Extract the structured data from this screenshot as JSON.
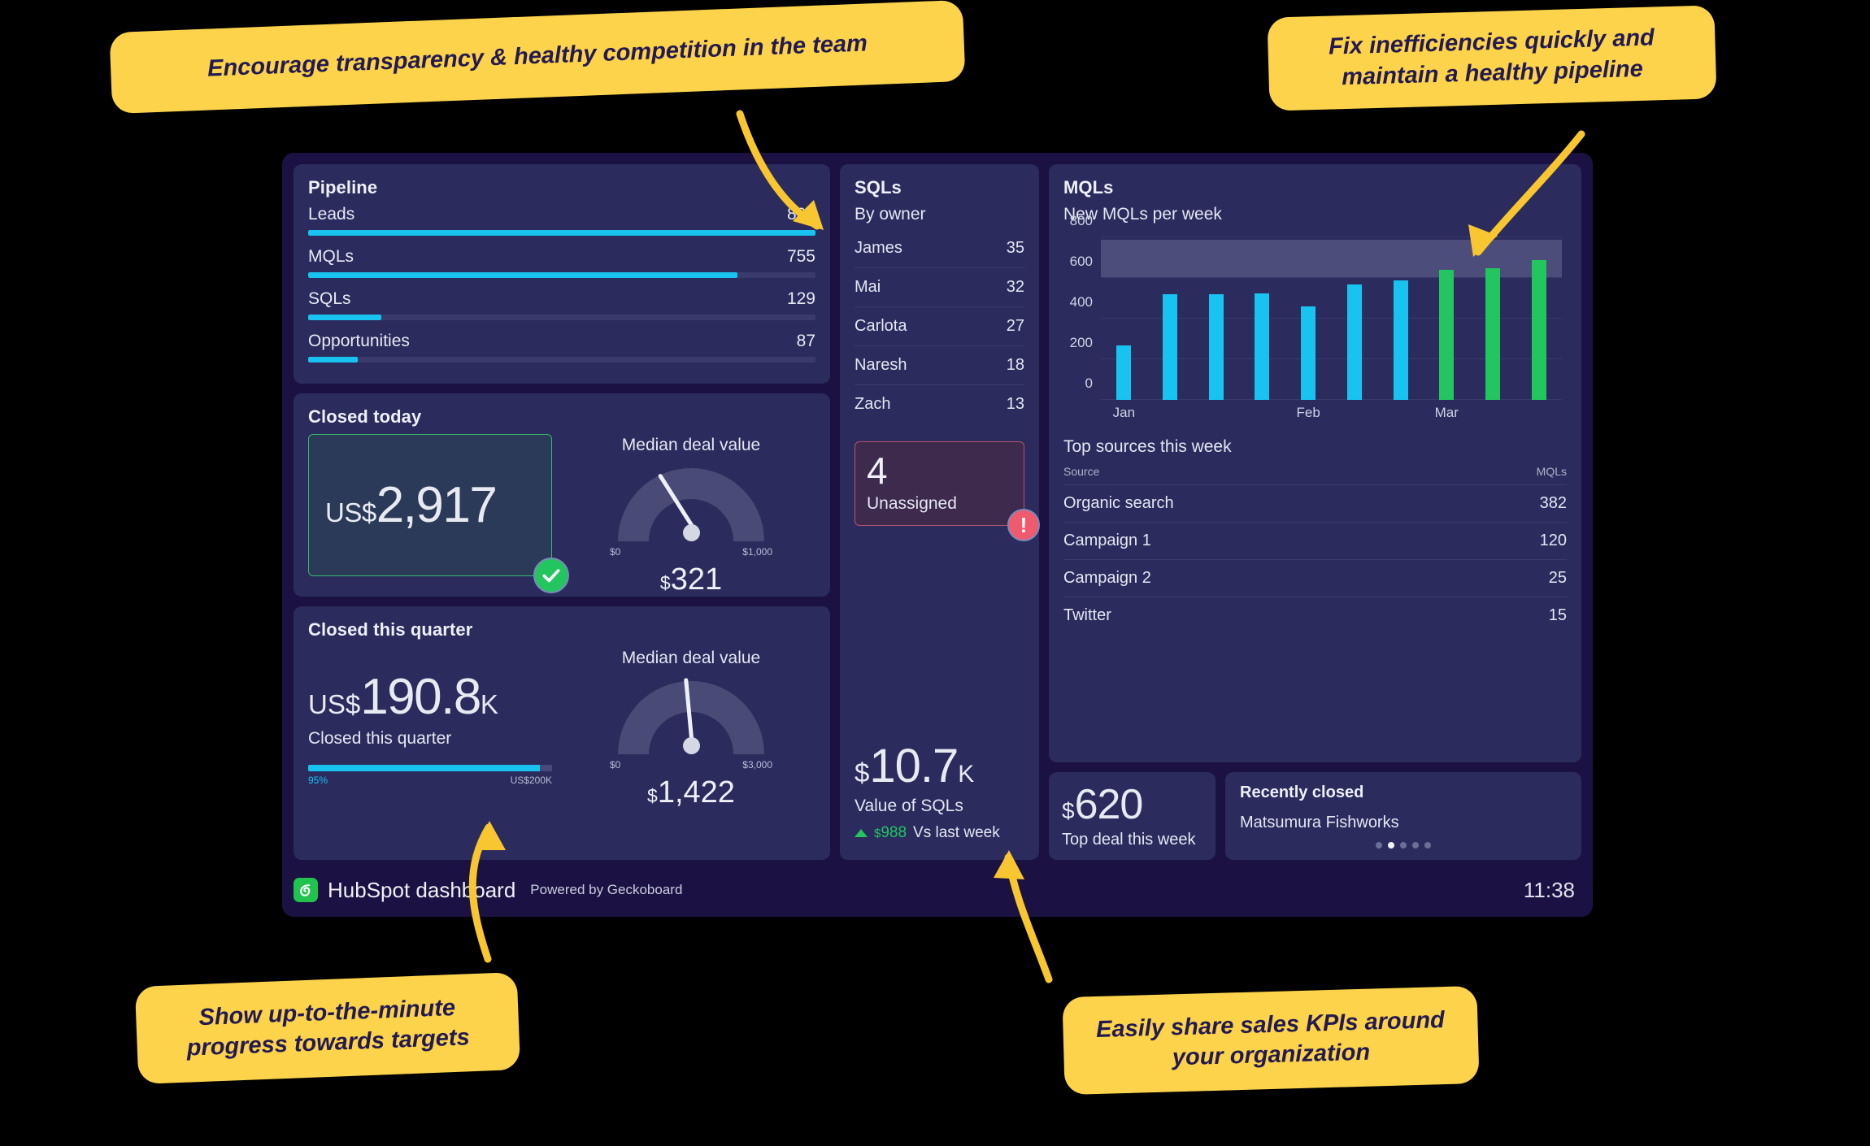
{
  "callouts": [
    {
      "id": "c1",
      "text": "Encourage transparency & healthy competition in the team"
    },
    {
      "id": "c2",
      "text": "Fix inefficiencies quickly and maintain a healthy pipeline"
    },
    {
      "id": "c3",
      "text": "Show up-to-the-minute progress towards targets"
    },
    {
      "id": "c4",
      "text": "Easily share sales KPIs around your organization"
    }
  ],
  "colors": {
    "accent_cyan": "#19c3f0",
    "accent_green": "#22c55e",
    "alert_red": "#f05a6e",
    "callout_yellow": "#FCD34A",
    "widget_bg": "#2b2b5e",
    "frame_bg": "#1b1243"
  },
  "pipeline": {
    "title": "Pipeline",
    "rows": [
      {
        "label": "Leads",
        "value": "892",
        "pct": 100
      },
      {
        "label": "MQLs",
        "value": "755",
        "pct": 84.6
      },
      {
        "label": "SQLs",
        "value": "129",
        "pct": 14.5
      },
      {
        "label": "Opportunities",
        "value": "87",
        "pct": 9.8
      }
    ]
  },
  "closed_today": {
    "title": "Closed today",
    "currency": "US$",
    "amount": "2,917",
    "gauge": {
      "label": "Median deal value",
      "min_label": "$0",
      "max_label": "$1,000",
      "value_currency": "$",
      "value": "321",
      "pct": 32
    }
  },
  "closed_quarter": {
    "title": "Closed this quarter",
    "currency": "US$",
    "amount": "190.8",
    "suffix": "K",
    "caption": "Closed this quarter",
    "progress_pct_label": "95%",
    "progress_pct": 95,
    "goal_label": "US$200K",
    "gauge": {
      "label": "Median deal value",
      "min_label": "$0",
      "max_label": "$3,000",
      "value_currency": "$",
      "value": "1,422",
      "pct": 47
    }
  },
  "sqls": {
    "title": "SQLs",
    "subtitle": "By owner",
    "owners": [
      {
        "name": "James",
        "count": "35"
      },
      {
        "name": "Mai",
        "count": "32"
      },
      {
        "name": "Carlota",
        "count": "27"
      },
      {
        "name": "Naresh",
        "count": "18"
      },
      {
        "name": "Zach",
        "count": "13"
      }
    ],
    "alert": {
      "number": "4",
      "caption": "Unassigned",
      "icon": "exclamation-icon"
    },
    "value": {
      "currency": "$",
      "number": "10.7",
      "suffix": "K",
      "caption": "Value of SQLs",
      "delta_currency": "$",
      "delta_amount": "988",
      "delta_text": "Vs last week",
      "delta_direction": "up"
    }
  },
  "mqls": {
    "title": "MQLs",
    "chart_title": "New MQLs per week",
    "sources_title": "Top sources this week",
    "table_headers": {
      "source": "Source",
      "mqls": "MQLs"
    },
    "sources": [
      {
        "source": "Organic search",
        "mqls": "382"
      },
      {
        "source": "Campaign 1",
        "mqls": "120"
      },
      {
        "source": "Campaign 2",
        "mqls": "25"
      },
      {
        "source": "Twitter",
        "mqls": "15"
      }
    ]
  },
  "chart_data": {
    "type": "bar",
    "title": "New MQLs per week",
    "xlabel": "",
    "ylabel": "",
    "ylim": [
      0,
      800
    ],
    "yticks": [
      0,
      200,
      400,
      600,
      800
    ],
    "grid": true,
    "legend": "none",
    "x": [
      "Jan w1",
      "Jan w2",
      "Jan w3",
      "Jan w4",
      "Feb w1",
      "Feb w2",
      "Feb w3",
      "Mar w1",
      "Mar w2",
      "Mar w3"
    ],
    "xtick_labels": [
      "Jan",
      "Feb",
      "Mar"
    ],
    "values": [
      270,
      520,
      520,
      525,
      460,
      570,
      590,
      640,
      650,
      690
    ],
    "bar_colors": [
      "cyan",
      "cyan",
      "cyan",
      "cyan",
      "cyan",
      "cyan",
      "cyan",
      "green",
      "green",
      "green"
    ],
    "goal_band": {
      "from": 600,
      "to": 790,
      "color": "#4d4d7c"
    }
  },
  "top_deal": {
    "currency": "$",
    "amount": "620",
    "caption": "Top deal this week"
  },
  "recently_closed": {
    "title": "Recently closed",
    "name": "Matsumura Fishworks",
    "dots_total": 5,
    "dots_active_index": 1
  },
  "footer": {
    "title": "HubSpot dashboard",
    "powered": "Powered by Geckoboard",
    "time": "11:38",
    "logo": "geckoboard-logo-icon"
  }
}
